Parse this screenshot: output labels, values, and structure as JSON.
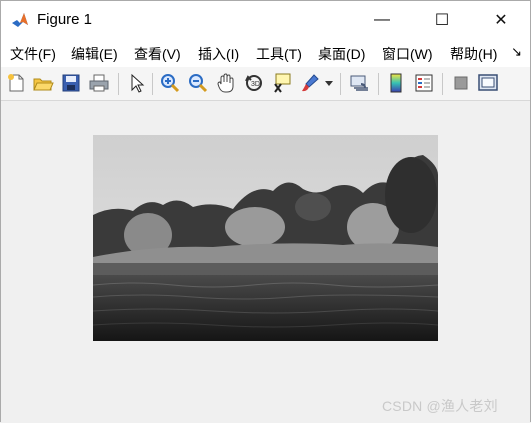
{
  "window": {
    "title": "Figure 1",
    "controls": {
      "minimize": "—",
      "maximize": "☐",
      "close": "✕"
    }
  },
  "menu": {
    "items": [
      {
        "label": "文件(F)"
      },
      {
        "label": "编辑(E)"
      },
      {
        "label": "查看(V)"
      },
      {
        "label": "插入(I)"
      },
      {
        "label": "工具(T)"
      },
      {
        "label": "桌面(D)"
      },
      {
        "label": "窗口(W)"
      },
      {
        "label": "帮助(H)"
      }
    ],
    "overflow_glyph": "↘"
  },
  "toolbar": {
    "icons": [
      "new-figure-icon",
      "open-file-icon",
      "save-icon",
      "print-icon",
      "pointer-icon",
      "zoom-in-icon",
      "zoom-out-icon",
      "pan-hand-icon",
      "rotate-3d-icon",
      "data-cursor-icon",
      "brush-icon",
      "link-plot-icon",
      "colorbar-icon",
      "legend-icon",
      "hide-plot-tools-icon",
      "show-plot-tools-icon"
    ]
  },
  "figure": {
    "image_alt": "grayscale landscape photo: lake in foreground, trees and grass bank, cloudy sky"
  },
  "watermark": "CSDN @渔人老刘",
  "colors": {
    "window_bg": "#f0f0f0",
    "titlebar_bg": "#ffffff",
    "matlab_orange": "#e8702a",
    "matlab_blue": "#2b6cc4"
  }
}
